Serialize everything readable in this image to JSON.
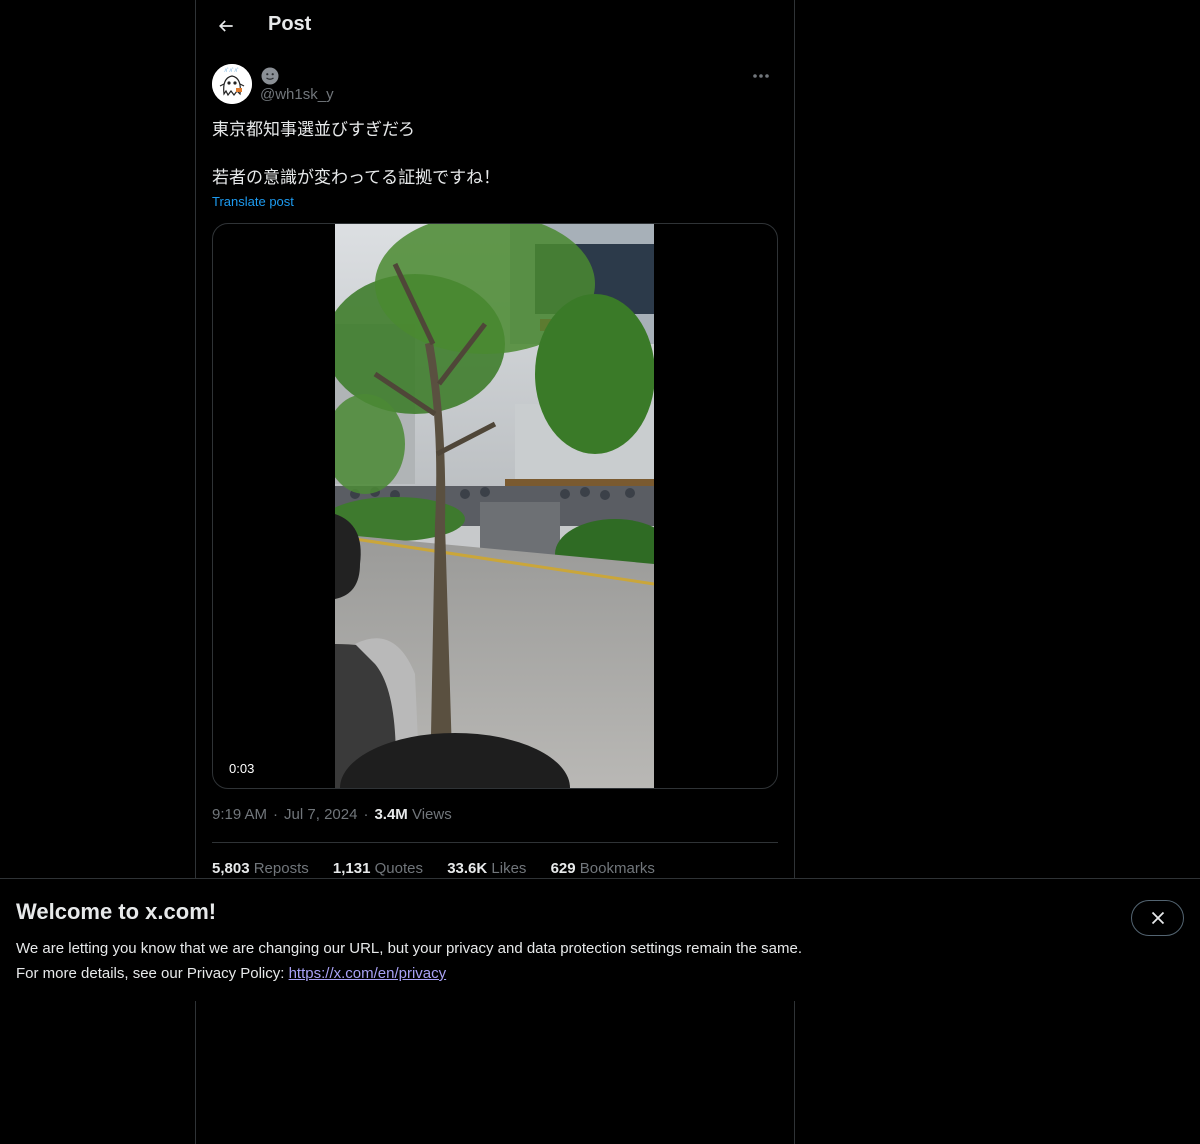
{
  "header": {
    "title": "Post",
    "back_icon": "arrow-left-icon"
  },
  "author": {
    "handle": "@wh1sk_y",
    "display_name_icon": "slightly-smiling-face-emoji",
    "avatar_icon": "ghost-avatar",
    "more_icon": "more-horizontal-icon"
  },
  "post": {
    "lines": [
      "東京都知事選並びすぎだろ",
      "若者の意識が変わってる証拠ですね！"
    ],
    "translate_label": "Translate post",
    "video": {
      "duration": "0:03"
    },
    "meta": {
      "time": "9:19 AM",
      "date": "Jul 7, 2024",
      "views_count": "3.4M",
      "views_label": "Views",
      "separator": "·"
    },
    "stats": [
      {
        "count": "5,803",
        "label": "Reposts"
      },
      {
        "count": "1,131",
        "label": "Quotes"
      },
      {
        "count": "33.6K",
        "label": "Likes"
      },
      {
        "count": "629",
        "label": "Bookmarks"
      }
    ]
  },
  "banner": {
    "title": "Welcome to x.com!",
    "line1": "We are letting you know that we are changing our URL, but your privacy and data protection settings remain the same.",
    "line2_prefix": "For more details, see our Privacy Policy: ",
    "link": "https://x.com/en/privacy",
    "close_icon": "close-icon"
  },
  "colors": {
    "background": "#000000",
    "text": "#e7e9ea",
    "secondary_text": "#71767b",
    "link": "#1d9bf0",
    "border": "#2f3336"
  }
}
